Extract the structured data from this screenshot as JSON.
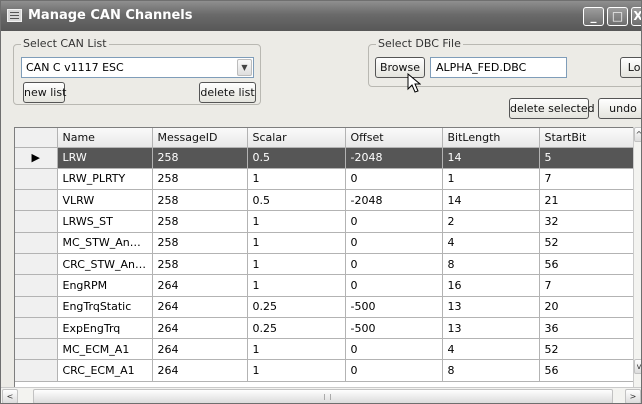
{
  "window": {
    "title": "Manage CAN Channels",
    "controls": {
      "minimize": "_",
      "maximize": "□",
      "close": "X"
    }
  },
  "can_list": {
    "group_label": "Select CAN List",
    "selected": "CAN C v1117 ESC",
    "new_label": "new list",
    "delete_label": "delete list"
  },
  "dbc": {
    "group_label": "Select DBC File",
    "browse_label": "Browse",
    "file_name": "ALPHA_FED.DBC",
    "load_label": "Load"
  },
  "actions": {
    "delete_selected_label": "delete selected",
    "undo_label": "undo"
  },
  "grid": {
    "columns": [
      "Name",
      "MessageID",
      "Scalar",
      "Offset",
      "BitLength",
      "StartBit"
    ],
    "rows": [
      {
        "selected": true,
        "indicator": "▶",
        "cells": [
          "LRW",
          "258",
          "0.5",
          "-2048",
          "14",
          "5"
        ]
      },
      {
        "selected": false,
        "indicator": "",
        "cells": [
          "LRW_PLRTY",
          "258",
          "1",
          "0",
          "1",
          "7"
        ]
      },
      {
        "selected": false,
        "indicator": "",
        "cells": [
          "VLRW",
          "258",
          "0.5",
          "-2048",
          "14",
          "21"
        ]
      },
      {
        "selected": false,
        "indicator": "",
        "cells": [
          "LRWS_ST",
          "258",
          "1",
          "0",
          "2",
          "32"
        ]
      },
      {
        "selected": false,
        "indicator": "",
        "cells": [
          "MC_STW_Angle...",
          "258",
          "1",
          "0",
          "4",
          "52"
        ]
      },
      {
        "selected": false,
        "indicator": "",
        "cells": [
          "CRC_STW_Angl...",
          "258",
          "1",
          "0",
          "8",
          "56"
        ]
      },
      {
        "selected": false,
        "indicator": "",
        "cells": [
          "EngRPM",
          "264",
          "1",
          "0",
          "16",
          "7"
        ]
      },
      {
        "selected": false,
        "indicator": "",
        "cells": [
          "EngTrqStatic",
          "264",
          "0.25",
          "-500",
          "13",
          "20"
        ]
      },
      {
        "selected": false,
        "indicator": "",
        "cells": [
          "ExpEngTrq",
          "264",
          "0.25",
          "-500",
          "13",
          "36"
        ]
      },
      {
        "selected": false,
        "indicator": "",
        "cells": [
          "MC_ECM_A1",
          "264",
          "1",
          "0",
          "4",
          "52"
        ]
      },
      {
        "selected": false,
        "indicator": "",
        "cells": [
          "CRC_ECM_A1",
          "264",
          "1",
          "0",
          "8",
          "56"
        ]
      }
    ]
  },
  "scrollbar": {
    "left_arrow": "<",
    "right_arrow": ">",
    "up_arrow": "^",
    "down_arrow": "v"
  },
  "icons": {
    "app": "window-icon",
    "combo_arrow": "chevron-down-icon",
    "cursor": "mouse-pointer-icon"
  }
}
